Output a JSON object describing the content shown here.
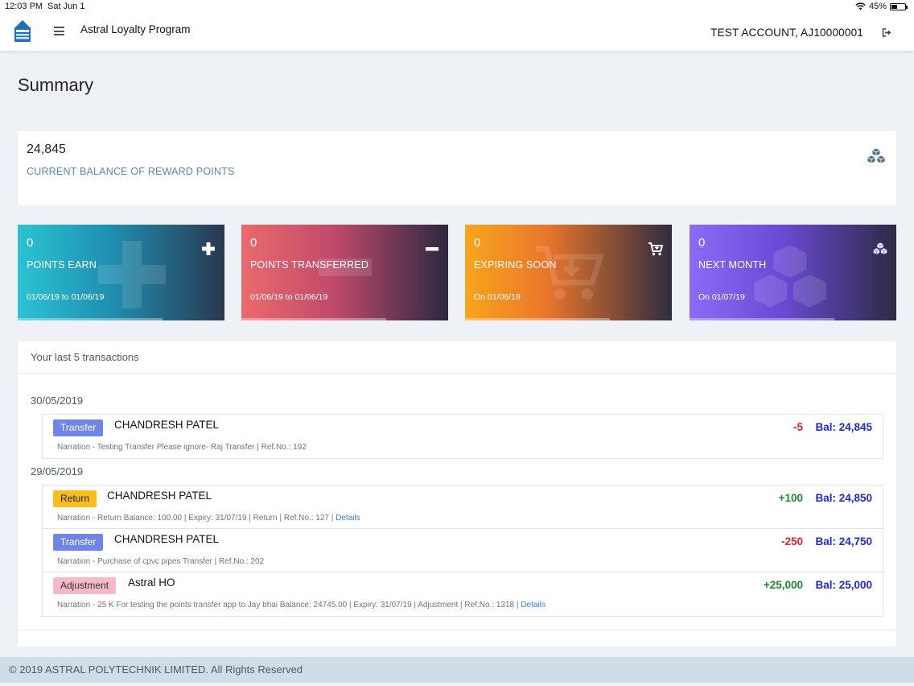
{
  "status_bar": {
    "time": "12:03 PM",
    "date": "Sat Jun 1",
    "battery": "45%",
    "battery_level": 0.45
  },
  "header": {
    "app_title": "Astral Loyalty Program",
    "account": "TEST ACCOUNT, AJ10000001",
    "logo_text": [
      "ASTRAL",
      "LOYALTY",
      "PROGRAM"
    ]
  },
  "page": {
    "title": "Summary"
  },
  "balance": {
    "value": "24,845",
    "label": "CURRENT BALANCE OF REWARD POINTS",
    "icon": "cubes-icon"
  },
  "stats": [
    {
      "value": "0",
      "label": "POINTS EARN",
      "date": "01/06/19 to 01/06/19",
      "icon": "plus-icon",
      "progress": 0.7
    },
    {
      "value": "0",
      "label": "POINTS TRANSFERRED",
      "date": "01/06/19 to 01/06/19",
      "icon": "minus-icon",
      "progress": 0.7
    },
    {
      "value": "0",
      "label": "EXPIRING SOON",
      "date": "On 01/06/19",
      "icon": "cart-icon",
      "progress": 0.7
    },
    {
      "value": "0",
      "label": "NEXT MONTH",
      "date": "On 01/07/19",
      "icon": "cubes-icon",
      "progress": 0.7
    }
  ],
  "transactions": {
    "heading": "Your last 5 transactions",
    "groups": [
      {
        "date": "30/05/2019",
        "items": [
          {
            "type": "Transfer",
            "name": "CHANDRESH PATEL",
            "narration": "Narration - Testing Transfer Please ignore- Raj   Transfer | Ref.No.: 192",
            "details": "",
            "amount": "-5",
            "balance": "Bal: 24,845"
          }
        ]
      },
      {
        "date": "29/05/2019",
        "items": [
          {
            "type": "Return",
            "name": "CHANDRESH PATEL",
            "narration": "Narration - Return   Balance: 100.00 | Expiry: 31/07/19 | Return | Ref.No.: 127 | ",
            "details": "Details",
            "amount": "+100",
            "balance": "Bal: 24,850"
          },
          {
            "type": "Transfer",
            "name": "CHANDRESH PATEL",
            "narration": "Narration - Purchase of cpvc pipes   Transfer | Ref.No.: 202",
            "details": "",
            "amount": "-250",
            "balance": "Bal: 24,750"
          },
          {
            "type": "Adjustment",
            "name": "Astral HO",
            "narration": "Narration - 25 K For testing the points transfer app to Jay bhai   Balance: 24745.00 | Expiry: 31/07/19 | Adjustment | Ref.No.: 1318 | ",
            "details": "Details",
            "amount": "+25,000",
            "balance": "Bal: 25,000"
          }
        ]
      }
    ]
  },
  "footer": {
    "text": "© 2019 ASTRAL POLYTECHNIK LIMITED. All Rights Reserved"
  },
  "colors": {
    "positive": "#1f8a2a",
    "negative": "#e02424",
    "balance": "#1f2ac8",
    "accent": "#5a8aa6"
  }
}
